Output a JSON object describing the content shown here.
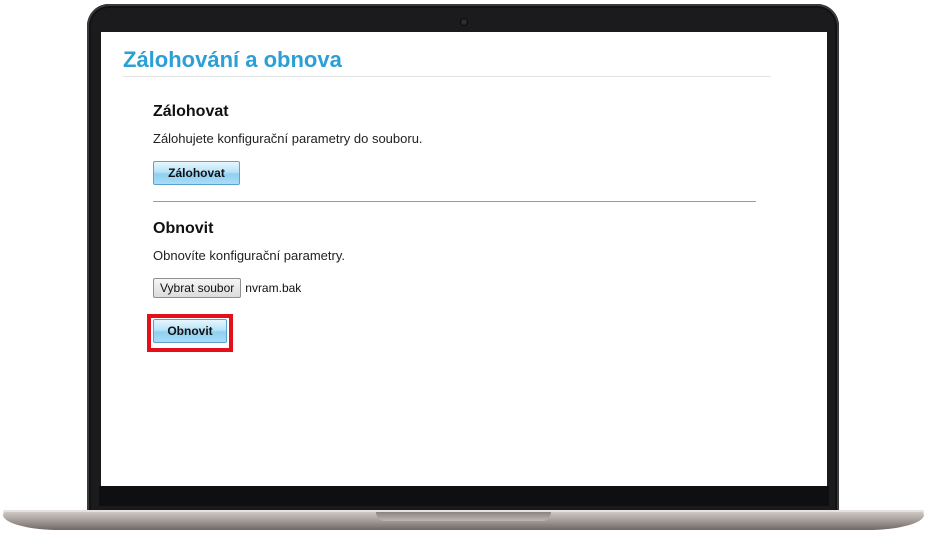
{
  "page": {
    "title": "Zálohování a obnova"
  },
  "backup": {
    "title": "Zálohovat",
    "description": "Zálohujete konfigurační parametry do souboru.",
    "button_label": "Zálohovat"
  },
  "restore": {
    "title": "Obnovit",
    "description": "Obnovíte konfigurační parametry.",
    "file_button_label": "Vybrat soubor",
    "file_name": "nvram.bak",
    "button_label": "Obnovit"
  },
  "colors": {
    "title": "#2b9fd6",
    "highlight": "#e3101c",
    "button_gradient_mid": "#b9e3f8"
  }
}
